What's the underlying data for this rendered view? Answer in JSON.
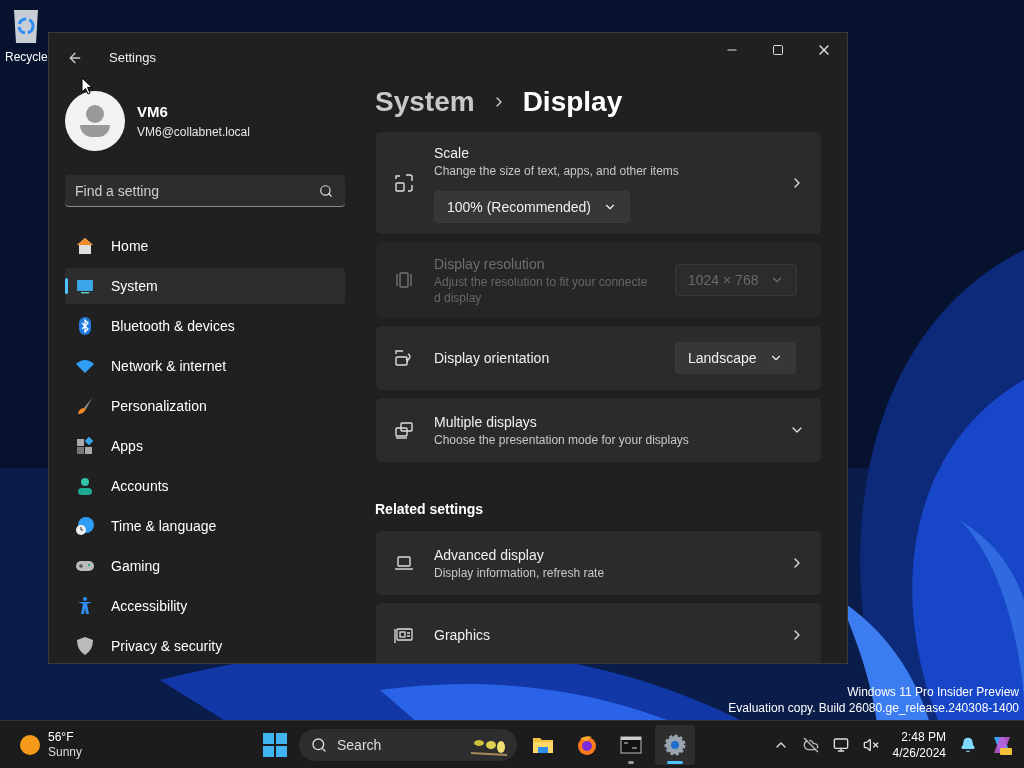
{
  "desktop": {
    "icons": [
      {
        "label": "Recycle"
      }
    ],
    "edition": [
      "Windows 11 Pro Insider Preview",
      "Evaluation copy. Build 26080.ge_release.240308-1400"
    ]
  },
  "window": {
    "title": "Settings"
  },
  "profile": {
    "name": "VM6",
    "email": "VM6@collabnet.local"
  },
  "search": {
    "placeholder": "Find a setting"
  },
  "nav": [
    {
      "label": "Home",
      "selected": false
    },
    {
      "label": "System",
      "selected": true
    },
    {
      "label": "Bluetooth & devices",
      "selected": false
    },
    {
      "label": "Network & internet",
      "selected": false
    },
    {
      "label": "Personalization",
      "selected": false
    },
    {
      "label": "Apps",
      "selected": false
    },
    {
      "label": "Accounts",
      "selected": false
    },
    {
      "label": "Time & language",
      "selected": false
    },
    {
      "label": "Gaming",
      "selected": false
    },
    {
      "label": "Accessibility",
      "selected": false
    },
    {
      "label": "Privacy & security",
      "selected": false
    }
  ],
  "breadcrumb": [
    "System",
    "Display"
  ],
  "cards": [
    {
      "kind": "link-with-dropdown",
      "title": "Scale",
      "description": "Change the size of text, apps, and other items",
      "dropdown": "100% (Recommended)",
      "disabled": false
    },
    {
      "kind": "dropdown",
      "title": "Display resolution",
      "description": "Adjust the resolution to fit your connecte d display",
      "dropdown": "1024 × 768",
      "disabled": true
    },
    {
      "kind": "dropdown",
      "title": "Display orientation",
      "dropdown": "Landscape",
      "disabled": false
    },
    {
      "kind": "expander",
      "title": "Multiple displays",
      "description": "Choose the presentation mode for your displays",
      "disabled": false
    }
  ],
  "related": {
    "heading": "Related settings",
    "cards": [
      {
        "kind": "link",
        "title": "Advanced display",
        "description": "Display information, refresh rate",
        "disabled": false
      },
      {
        "kind": "link",
        "title": "Graphics",
        "disabled": false
      }
    ]
  },
  "taskbar": {
    "weather": {
      "temperature": "56°F",
      "condition": "Sunny"
    },
    "search_placeholder": "Search",
    "apps": [
      {
        "running": false,
        "selected": false
      },
      {
        "running": false,
        "selected": false
      },
      {
        "running": true,
        "selected": false
      },
      {
        "running": true,
        "selected": true
      }
    ],
    "clock": {
      "time": "2:48 PM",
      "date": "4/26/2024"
    }
  }
}
